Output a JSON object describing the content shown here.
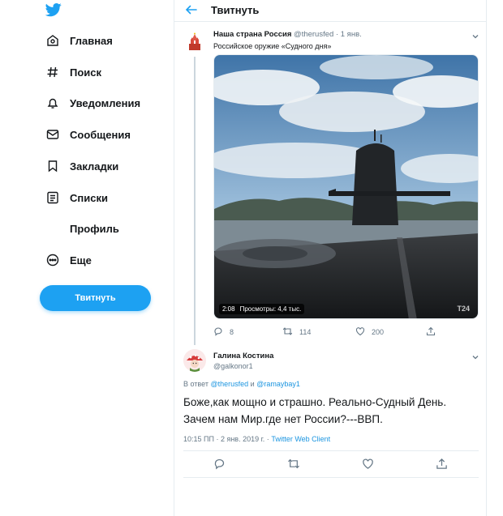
{
  "colors": {
    "accent": "#1da1f2",
    "link": "#1b95e0",
    "muted": "#657786",
    "border": "#e6ecf0"
  },
  "sidebar": {
    "logo_icon": "twitter-bird-icon",
    "items": [
      {
        "label": "Главная",
        "icon": "home-icon"
      },
      {
        "label": "Поиск",
        "icon": "hashtag-icon"
      },
      {
        "label": "Уведомления",
        "icon": "bell-icon"
      },
      {
        "label": "Сообщения",
        "icon": "envelope-icon"
      },
      {
        "label": "Закладки",
        "icon": "bookmark-icon"
      },
      {
        "label": "Списки",
        "icon": "list-icon"
      },
      {
        "label": "Профиль",
        "icon": "profile-icon"
      },
      {
        "label": "Еще",
        "icon": "more-icon"
      }
    ],
    "tweet_button": "Твитнуть"
  },
  "header": {
    "title": "Твитнуть"
  },
  "tweet1": {
    "name": "Наша страна Россия",
    "handle": "@therusfed",
    "date": "· 1 янв.",
    "text": "Российское оружие «Судного дня»",
    "video": {
      "duration": "2:08",
      "views": "Просмотры: 4,4 тыс.",
      "channel_logo": "T24"
    },
    "actions": {
      "replies": "8",
      "retweets": "114",
      "likes": "200"
    }
  },
  "tweet2": {
    "name": "Галина Костина",
    "handle": "@galkonor1",
    "reply_prefix": "В ответ",
    "reply_user1": "@therusfed",
    "reply_and": "и",
    "reply_user2": "@ramaybay1",
    "text": "Боже,как мощно и страшно. Реально-Судный День. Зачем нам Мир.где нет России?---ВВП.",
    "timestamp": "10:15 ПП · 2 янв. 2019 г. ·",
    "client": "Twitter Web Client"
  }
}
